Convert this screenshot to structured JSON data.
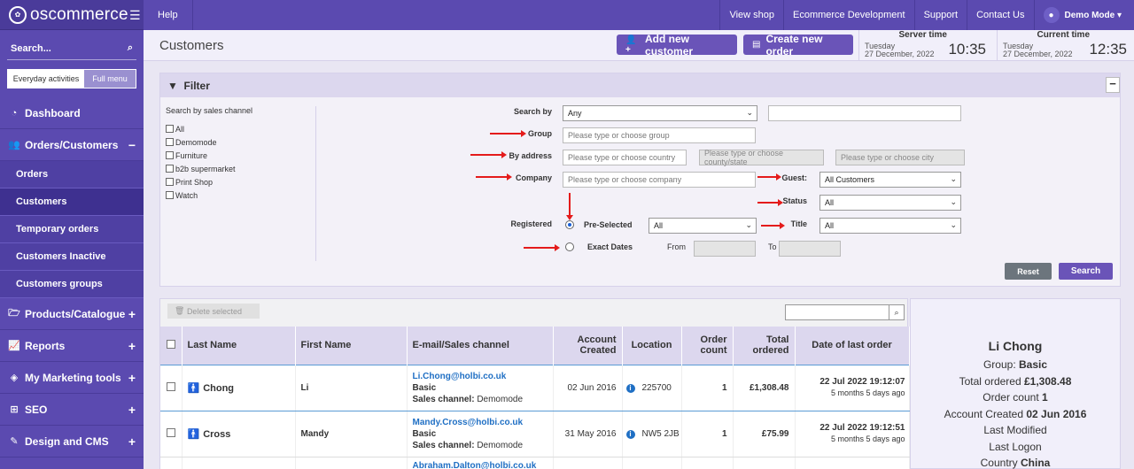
{
  "app": {
    "logo": "oscommerce"
  },
  "sidebar": {
    "search_label": "Search...",
    "toggle": {
      "left": "Everyday activities",
      "right": "Full menu"
    },
    "items": [
      {
        "label": "Dashboard",
        "icon": "dashboard-icon"
      },
      {
        "label": "Orders/Customers",
        "icon": "users-icon",
        "toggle": "−"
      },
      {
        "label": "Products/Catalogue",
        "icon": "folder-icon",
        "toggle": "+"
      },
      {
        "label": "Reports",
        "icon": "chart-icon",
        "toggle": "+"
      },
      {
        "label": "My Marketing tools",
        "icon": "tag-icon",
        "toggle": "+"
      },
      {
        "label": "SEO",
        "icon": "sitemap-icon",
        "toggle": "+"
      },
      {
        "label": "Design and CMS",
        "icon": "brush-icon",
        "toggle": "+"
      }
    ],
    "subitems": [
      "Orders",
      "Customers",
      "Temporary orders",
      "Customers Inactive",
      "Customers groups"
    ]
  },
  "topbar": {
    "help": "Help",
    "links": [
      "View shop",
      "Ecommerce Development",
      "Support",
      "Contact Us"
    ],
    "user": "Demo Mode"
  },
  "header": {
    "title": "Customers",
    "add_customer": "Add new customer",
    "create_order": "Create new order",
    "server_time": {
      "label": "Server time",
      "day": "Tuesday",
      "date": "27 December, 2022",
      "time": "10:35"
    },
    "current_time": {
      "label": "Current time",
      "day": "Tuesday",
      "date": "27 December, 2022",
      "time": "12:35"
    }
  },
  "filter": {
    "title": "Filter",
    "collapse": "−",
    "channels_title": "Search by sales channel",
    "channels": [
      "All",
      "Demomode",
      "Furniture",
      "b2b supermarket",
      "Print Shop",
      "Watch"
    ],
    "search_by_label": "Search by",
    "search_by_value": "Any",
    "group_label": "Group",
    "group_placeholder": "Please type or choose group",
    "address_label": "By address",
    "country_placeholder": "Please type or choose country",
    "county_placeholder": "Please type or choose county/state",
    "city_placeholder": "Please type or choose city",
    "company_label": "Company",
    "company_placeholder": "Please type or choose company",
    "guest_label": "Guest:",
    "guest_value": "All Customers",
    "status_label": "Status",
    "status_value": "All",
    "registered_label": "Registered",
    "preselected_label": "Pre-Selected",
    "preselected_value": "All",
    "title_label": "Title",
    "title_value": "All",
    "exact_dates_label": "Exact Dates",
    "from_label": "From",
    "to_label": "To",
    "reset": "Reset",
    "search": "Search"
  },
  "table": {
    "delete_selected": "Delete selected",
    "columns": [
      "Last Name",
      "First Name",
      "E-mail/Sales channel",
      "Account Created",
      "Location",
      "Order count",
      "Total ordered",
      "Date of last order"
    ],
    "rows": [
      {
        "last": "Chong",
        "first": "Li",
        "email": "Li.Chong@holbi.co.uk",
        "group": "Basic",
        "channel_label": "Sales channel:",
        "channel": "Demomode",
        "created": "02 Jun 2016",
        "location": "225700",
        "orders": "1",
        "total": "£1,308.48",
        "last_order": "22 Jul 2022 19:12:07",
        "ago": "5 months 5 days ago"
      },
      {
        "last": "Cross",
        "first": "Mandy",
        "email": "Mandy.Cross@holbi.co.uk",
        "group": "Basic",
        "channel_label": "Sales channel:",
        "channel": "Demomode",
        "created": "31 May 2016",
        "location": "NW5 2JB",
        "orders": "1",
        "total": "£75.99",
        "last_order": "22 Jul 2022 19:12:51",
        "ago": "5 months 5 days ago"
      },
      {
        "email": "Abraham.Dalton@holbi.co.uk"
      }
    ]
  },
  "detail": {
    "name": "Li Chong",
    "group_label": "Group:",
    "group": "Basic",
    "total_label": "Total ordered",
    "total": "£1,308.48",
    "count_label": "Order count",
    "count": "1",
    "created_label": "Account Created",
    "created": "02 Jun 2016",
    "modified_label": "Last Modified",
    "logon_label": "Last Logon",
    "country_label": "Country",
    "country": "China"
  }
}
